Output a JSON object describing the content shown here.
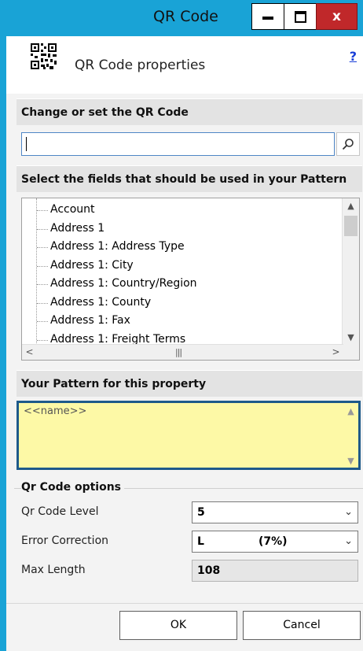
{
  "window": {
    "title": "QR Code",
    "close_glyph": "x"
  },
  "header": {
    "title": "QR Code properties",
    "help": "?"
  },
  "sections": {
    "change_code": "Change or set the QR Code",
    "select_fields": "Select the fields that should be used in your Pattern",
    "pattern": "Your Pattern for this property"
  },
  "search": {
    "value": ""
  },
  "fields_tree": {
    "items": [
      "Account",
      "Address 1",
      "Address 1: Address Type",
      "Address 1: City",
      "Address 1: Country/Region",
      "Address 1: County",
      "Address 1: Fax",
      "Address 1: Freight Terms"
    ]
  },
  "pattern": {
    "value": "<<name>>"
  },
  "options": {
    "title": "Qr Code options",
    "level": {
      "label": "Qr Code Level",
      "value": "5"
    },
    "error_correction": {
      "label": "Error Correction",
      "value": "L",
      "percent": "(7%)"
    },
    "max_length": {
      "label": "Max Length",
      "value": "108"
    }
  },
  "buttons": {
    "ok": "OK",
    "cancel": "Cancel"
  },
  "colors": {
    "titlebar": "#19a3d6",
    "pattern_bg": "#fdf9a6",
    "pattern_border": "#1e5a8a",
    "help_link": "#1a3fd8"
  }
}
